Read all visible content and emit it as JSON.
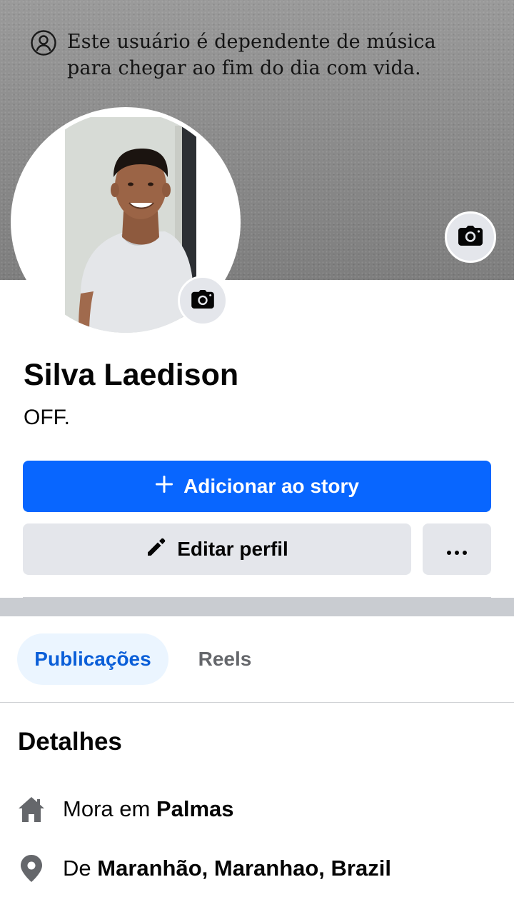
{
  "cover": {
    "quote_line1": "Este usuário é dependente de música",
    "quote_line2": "para chegar ao fim do dia com vida."
  },
  "profile": {
    "name": "Silva Laedison",
    "bio": "OFF."
  },
  "actions": {
    "add_story_label": "Adicionar ao story",
    "edit_profile_label": "Editar perfil",
    "more_label": "•••"
  },
  "tabs": [
    {
      "label": "Publicações",
      "selected": true
    },
    {
      "label": "Reels",
      "selected": false
    }
  ],
  "details": {
    "title": "Detalhes",
    "lives_prefix": "Mora em ",
    "lives_city": "Palmas",
    "from_prefix": "De ",
    "from_place": "Maranhão, Maranhao, Brazil"
  },
  "icons": {
    "cover_camera": "camera-icon",
    "avatar_camera": "camera-icon",
    "quote_person": "person-circle-icon",
    "add": "plus-icon",
    "edit": "pencil-icon",
    "more": "more-dots-icon",
    "home": "home-icon",
    "location": "location-pin-icon"
  },
  "colors": {
    "primary": "#0866ff",
    "button_secondary": "#e4e6eb",
    "tab_selected_bg": "#ebf5ff",
    "tab_selected_text": "#0a5ed8",
    "muted_text": "#65676b"
  }
}
